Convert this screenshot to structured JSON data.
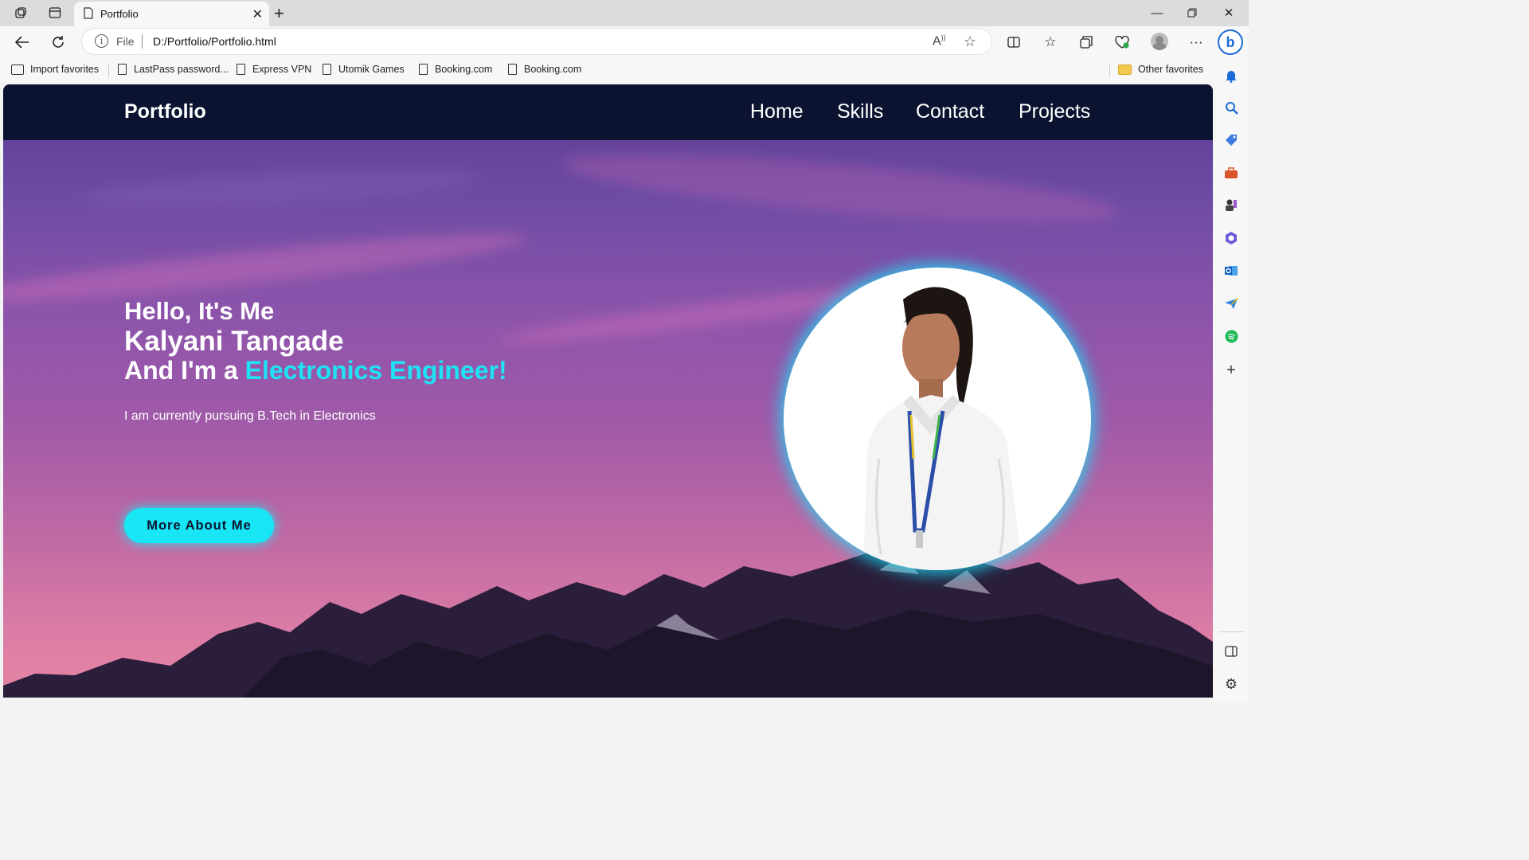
{
  "browser": {
    "tab_title": "Portfolio",
    "url_scheme": "File",
    "url": "D:/Portfolio/Portfolio.html"
  },
  "favorites": {
    "items": [
      {
        "label": "Import favorites",
        "icon": "import-icon"
      },
      {
        "label": "LastPass password...",
        "icon": "page-icon"
      },
      {
        "label": "Express VPN",
        "icon": "page-icon"
      },
      {
        "label": "Utomik Games",
        "icon": "page-icon"
      },
      {
        "label": "Booking.com",
        "icon": "page-icon"
      },
      {
        "label": "Booking.com",
        "icon": "page-icon"
      }
    ],
    "other": "Other favorites"
  },
  "site": {
    "brand": "Portfolio",
    "nav": [
      "Home",
      "Skills",
      "Contact",
      "Projects"
    ],
    "hero": {
      "hello": "Hello, It's Me",
      "name": "Kalyani Tangade",
      "role_prefix": "And I'm a ",
      "role_accent": "Electronics Engineer!",
      "description": "I am currently pursuing B.Tech in Electronics",
      "cta": "More About Me"
    },
    "colors": {
      "navbar": "#0b1330",
      "accent": "#1fe2f4"
    }
  }
}
